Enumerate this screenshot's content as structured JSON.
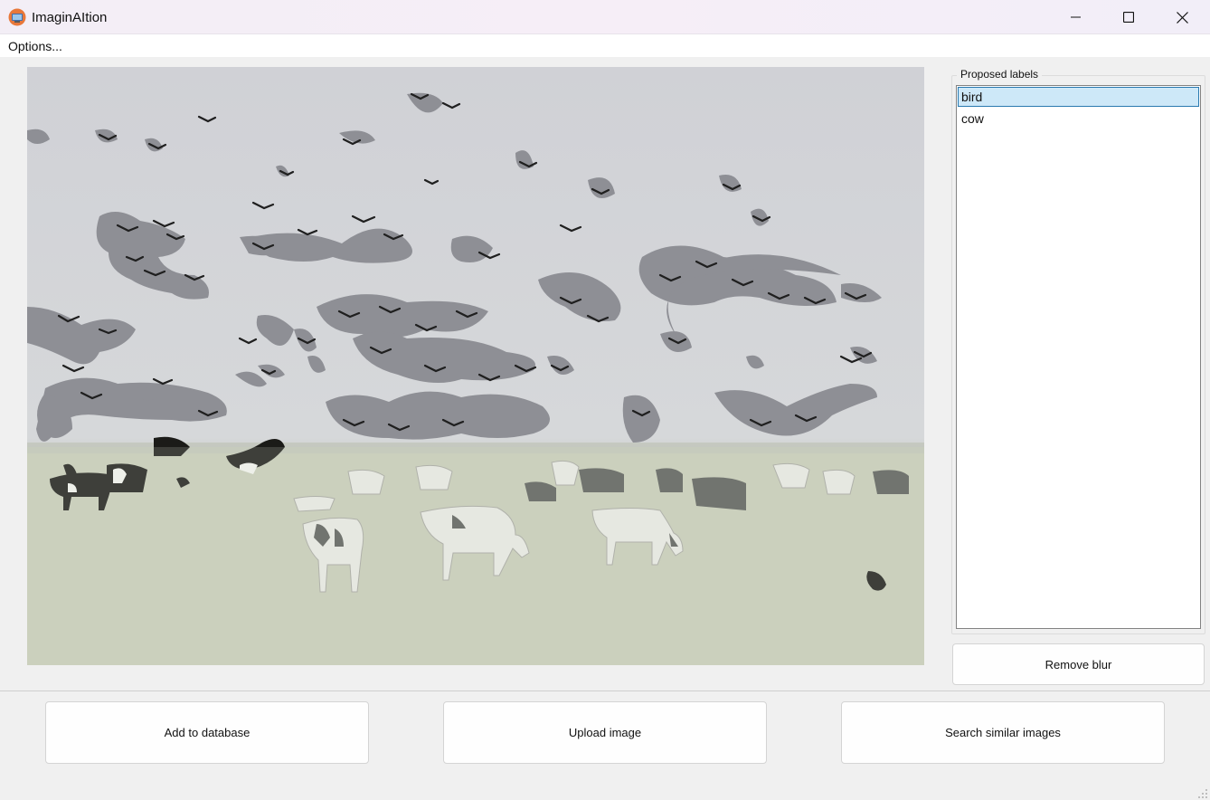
{
  "window": {
    "title": "ImaginAItion",
    "controls": {
      "minimize_icon": "minimize-icon",
      "maximize_icon": "maximize-icon",
      "close_icon": "close-icon"
    }
  },
  "menu": {
    "options_label": "Options..."
  },
  "image_panel": {
    "description_icon": "photo-canvas",
    "highlighted_label": "bird"
  },
  "proposed_labels": {
    "title": "Proposed labels",
    "items": [
      {
        "label": "bird",
        "selected": true
      },
      {
        "label": "cow",
        "selected": false
      }
    ]
  },
  "buttons": {
    "remove_blur": "Remove blur",
    "add_to_database": "Add to database",
    "upload_image": "Upload image",
    "search_similar": "Search similar images"
  },
  "colors": {
    "selection_bg": "#cde8f8",
    "selection_border": "#2a7ab0",
    "mask_color": "#8e8f95"
  }
}
